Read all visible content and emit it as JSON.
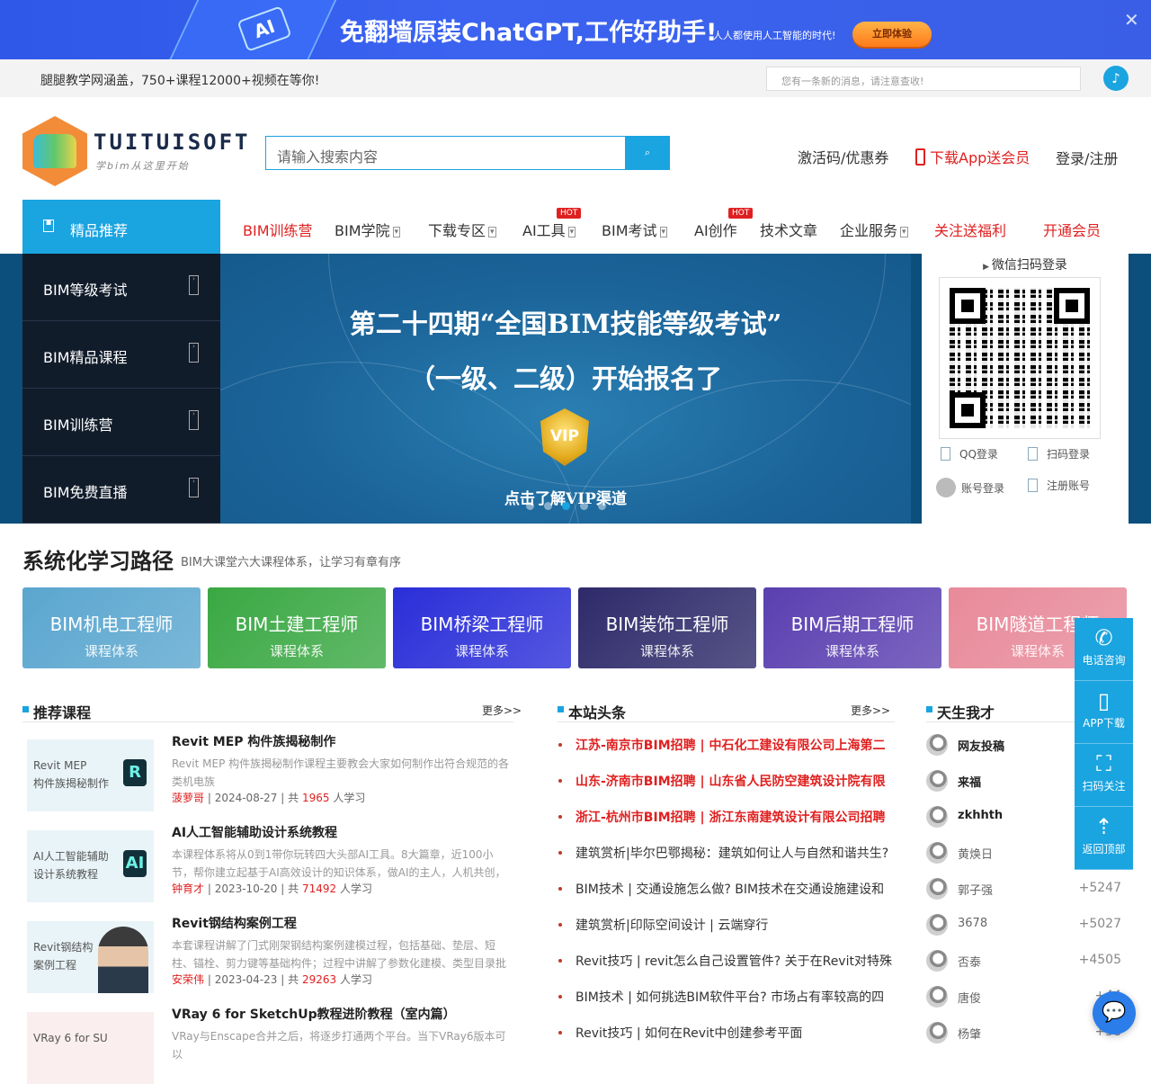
{
  "top_banner": {
    "title": "免翻墙原装ChatGPT,工作好助手!",
    "subtitle": "人人都使用人工智能的时代!",
    "button": "立即体验",
    "chip_label": "AI",
    "close": "✕"
  },
  "notice_bar": {
    "left_text": "腿腿教学网涵盖，750+课程12000+视频在等你!",
    "input_placeholder": "您有一条新的消息，请注意查收!"
  },
  "header": {
    "logo_word": "TUITUISOFT",
    "logo_slogan": "学bim从这里开始",
    "search_placeholder": "请输入搜索内容",
    "coupon": "激活码/优惠券",
    "app": "下载App送会员",
    "login": "登录/注册"
  },
  "nav": {
    "featured": "精品推荐",
    "items": [
      {
        "label": "BIM训练营",
        "red": true,
        "hot": false,
        "caret": false
      },
      {
        "label": "BIM学院",
        "red": false,
        "hot": false,
        "caret": true
      },
      {
        "label": "下载专区",
        "red": false,
        "hot": false,
        "caret": true
      },
      {
        "label": "AI工具",
        "red": false,
        "hot": true,
        "caret": true
      },
      {
        "label": "BIM考试",
        "red": false,
        "hot": false,
        "caret": true
      },
      {
        "label": "AI创作",
        "red": false,
        "hot": true,
        "caret": false
      },
      {
        "label": "技术文章",
        "red": false,
        "hot": false,
        "caret": false
      },
      {
        "label": "企业服务",
        "red": false,
        "hot": false,
        "caret": true
      },
      {
        "label": "关注送福利",
        "red": true,
        "hot": false,
        "caret": false
      },
      {
        "label": "开通会员",
        "red": true,
        "hot": false,
        "caret": false
      }
    ],
    "hot_label": "HOT"
  },
  "side_menu": [
    "BIM等级考试",
    "BIM精品课程",
    "BIM训练营",
    "BIM免费直播"
  ],
  "slide": {
    "title1": "第二十四期“全国BIM技能等级考试”",
    "title2": "（一级、二级）开始报名了",
    "badge": "VIP",
    "cta": "点击了解VIP渠道",
    "dots": 5,
    "active_dot": 3
  },
  "login_box": {
    "qr_title": "微信扫码登录",
    "options": [
      "QQ登录",
      "扫码登录",
      "账号登录",
      "注册账号"
    ]
  },
  "learning_path": {
    "title": "系统化学习路径",
    "subtitle": "BIM大课堂六大课程体系，让学习有章有序",
    "cards": [
      {
        "title": "BIM机电工程师",
        "sub": "课程体系",
        "color": "#5aa6cf"
      },
      {
        "title": "BIM土建工程师",
        "sub": "课程体系",
        "color": "#3aa843"
      },
      {
        "title": "BIM桥梁工程师",
        "sub": "课程体系",
        "color": "#2a2ed8"
      },
      {
        "title": "BIM装饰工程师",
        "sub": "课程体系",
        "color": "#2e2a6a"
      },
      {
        "title": "BIM后期工程师",
        "sub": "课程体系",
        "color": "#5a3fb0"
      },
      {
        "title": "BIM隧道工程师",
        "sub": "课程体系",
        "color": "#e88a9a"
      }
    ]
  },
  "recommended": {
    "title": "推荐课程",
    "more": "更多>>",
    "courses": [
      {
        "thumb": "Revit MEP\n构件族揭秘制作",
        "icon": "R",
        "title": "Revit MEP 构件族揭秘制作",
        "desc": "Revit MEP 构件族揭秘制作课程主要教会大家如何制作出符合规范的各类机电族",
        "author": "菠萝哥",
        "date": "2024-08-27",
        "count": "1965",
        "total_prefix": "共",
        "suffix": "人学习"
      },
      {
        "thumb": "AI人工智能辅助\n设计系统教程",
        "icon": "AI",
        "title": "AI人工智能辅助设计系统教程",
        "desc": "本课程体系将从0到1带你玩转四大头部AI工具。8大篇章，近100小节，帮你建立起基于AI高效设计的知识体系，做AI的主人，人机共创，降本",
        "author": "钟育才",
        "date": "2023-10-20",
        "count": "71492",
        "total_prefix": "共",
        "suffix": "人学习"
      },
      {
        "thumb": "Revit钢结构\n案例工程",
        "icon": "",
        "title": "Revit钢结构案例工程",
        "desc": "本套课程讲解了门式刚架钢结构案例建模过程，包括基础、垫层、短柱、锚栓、剪力键等基础构件；过程中讲解了参数化建模、类型目录批",
        "author": "安荣伟",
        "date": "2023-04-23",
        "count": "29263",
        "total_prefix": "共",
        "suffix": "人学习"
      },
      {
        "thumb": "VRay 6 for SU",
        "icon": "",
        "title": "VRay 6 for SketchUp教程进阶教程（室内篇）",
        "desc": "VRay与Enscape合并之后，将逐步打通两个平台。当下VRay6版本可以",
        "author": "",
        "date": "",
        "count": "",
        "total_prefix": "",
        "suffix": ""
      }
    ]
  },
  "headlines": {
    "title": "本站头条",
    "more": "更多>>",
    "items": [
      {
        "text": "江苏-南京市BIM招聘 | 中石化工建设有限公司上海第二",
        "red": true
      },
      {
        "text": "山东-济南市BIM招聘 | 山东省人民防空建筑设计院有限",
        "red": true
      },
      {
        "text": "浙江-杭州市BIM招聘 | 浙江东南建筑设计有限公司招聘",
        "red": true
      },
      {
        "text": "建筑赏析|毕尔巴鄂揭秘：建筑如何让人与自然和谐共生?",
        "red": false
      },
      {
        "text": "BIM技术 | 交通设施怎么做? BIM技术在交通设施建设和",
        "red": false
      },
      {
        "text": "建筑赏析|印际空间设计 | 云端穿行",
        "red": false
      },
      {
        "text": "Revit技巧 | revit怎么自己设置管件? 关于在Revit对特殊",
        "red": false
      },
      {
        "text": "BIM技术 | 如何挑选BIM软件平台? 市场占有率较高的四",
        "red": false
      },
      {
        "text": "Revit技巧 | 如何在Revit中创建参考平面",
        "red": false
      }
    ]
  },
  "talent": {
    "title": "天生我才",
    "items": [
      {
        "name": "网友投稿",
        "score": "",
        "bold": true
      },
      {
        "name": "来福",
        "score": "",
        "bold": true
      },
      {
        "name": "zkhhth",
        "score": "",
        "bold": true
      },
      {
        "name": "黄焕日",
        "score": "",
        "bold": false
      },
      {
        "name": "郭子强",
        "score": "+5247",
        "bold": false
      },
      {
        "name": "3678",
        "score": "+5027",
        "bold": false
      },
      {
        "name": "否泰",
        "score": "+4505",
        "bold": false
      },
      {
        "name": "唐俊",
        "score": "+44",
        "bold": false
      },
      {
        "name": "杨肇",
        "score": "+38",
        "bold": false
      }
    ]
  },
  "float_bar": [
    "电话咨询",
    "APP下载",
    "扫码关注",
    "返回顶部"
  ],
  "chat_icon": "chat-bubble-icon"
}
